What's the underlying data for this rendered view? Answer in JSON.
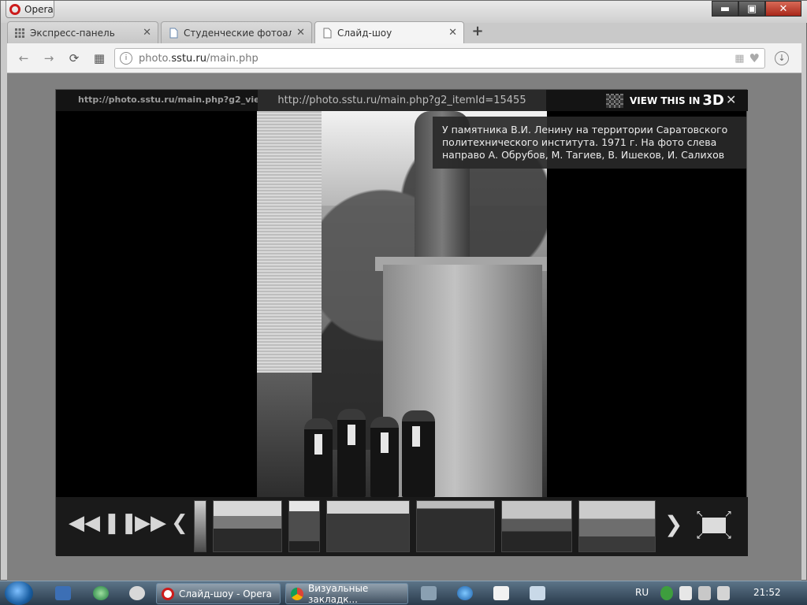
{
  "opera_menu": {
    "label": "Opera"
  },
  "window_controls": {
    "minimize": "▬",
    "maximize": "▣",
    "close": "✕"
  },
  "tabs": [
    {
      "label": "Экспресс-панель",
      "icon": "grid-icon"
    },
    {
      "label": "Студенческие фотоальбо",
      "icon": "page-icon"
    },
    {
      "label": "Слайд-шоу",
      "icon": "page-icon"
    }
  ],
  "tab_close": "✕",
  "new_tab": "+",
  "address": {
    "scheme_prefix": "photo.",
    "host": "sstu.ru",
    "path": "/main.php"
  },
  "slideshow": {
    "left_url": "http://photo.sstu.ru/main.php?g2_vie...",
    "center_url": "http://photo.sstu.ru/main.php?g2_itemId=15455",
    "view_label": "VIEW THIS IN",
    "view_3d": "3D",
    "close": "✕",
    "caption": "У памятника В.И. Ленину на территории Саратовского политехнического института. 1971 г. На фото слева направо А. Обрубов, М. Тагиев, В. Ишеков, И. Салихов",
    "controls": {
      "rewind": "◀◀",
      "pause": "❚❚",
      "forward": "▶▶",
      "prev": "❮",
      "next": "❯"
    }
  },
  "thumbnails": [
    {
      "name": "thumb-1"
    },
    {
      "name": "thumb-2"
    },
    {
      "name": "thumb-3"
    },
    {
      "name": "thumb-4"
    },
    {
      "name": "thumb-5"
    },
    {
      "name": "thumb-6"
    },
    {
      "name": "thumb-7"
    }
  ],
  "taskbar": {
    "tasks": [
      {
        "label": "Слайд-шоу - Opera"
      },
      {
        "label": "Визуальные закладк..."
      }
    ],
    "language": "RU",
    "clock": "21:52"
  },
  "colors": {
    "accent_red": "#cc1b1b",
    "taskbar": "#2a3b4c"
  }
}
